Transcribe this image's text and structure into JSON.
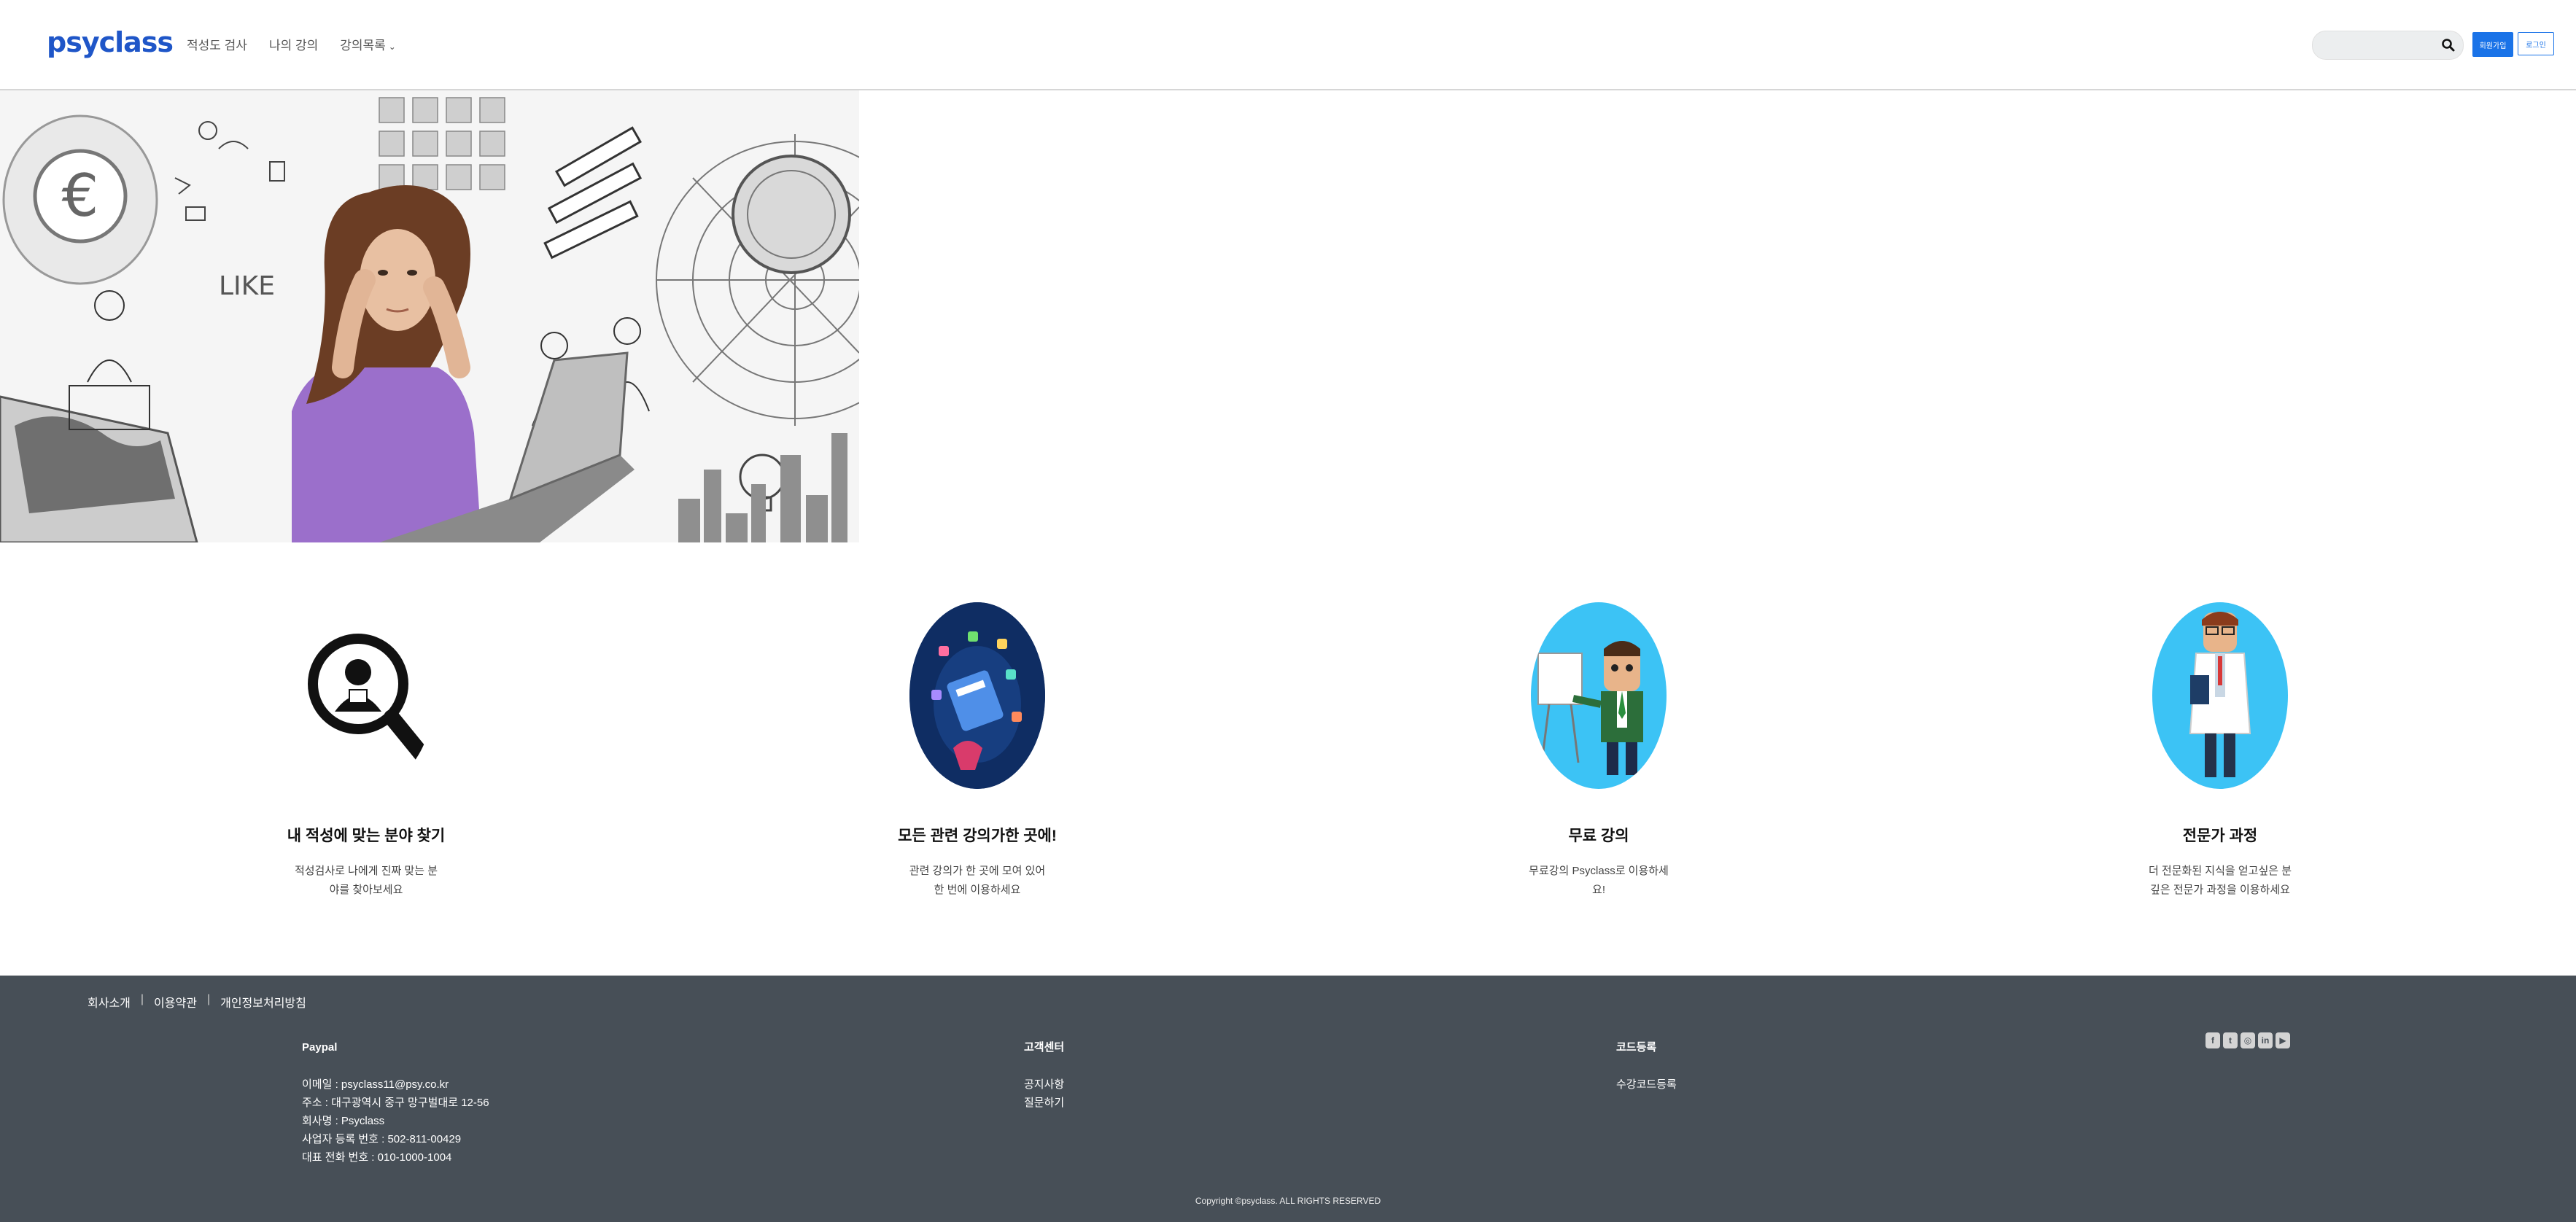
{
  "header": {
    "logo": "psyclass",
    "nav": [
      "적성도 검사",
      "나의 강의",
      "강의목록"
    ],
    "nav_caret": "⌄",
    "search_placeholder": "",
    "join_label": "회원가입",
    "login_label": "로그인"
  },
  "hero": {
    "icon": "collage-stressed-woman-laptop-image"
  },
  "features": [
    {
      "icon": "magnifier-person-icon",
      "title": "내 적성에 맞는 분야 찾기",
      "desc": "적성검사로 나에게 진짜 맞는 분야를 찾아보세요"
    },
    {
      "icon": "apps-illustration-icon",
      "title": "모든 관련 강의가한 곳에!",
      "desc": "관련 강의가 한 곳에 모여 있어 한 번에 이용하세요"
    },
    {
      "icon": "presenter-man-icon",
      "title": "무료 강의",
      "desc": "무료강의 Psyclass로 이용하세요!"
    },
    {
      "icon": "doctor-expert-icon",
      "title": "전문가 과정",
      "desc": "더 전문화된 지식을 얻고싶은 분 깊은 전문가 과정을 이용하세요"
    }
  ],
  "footer": {
    "links": [
      "회사소개",
      "이용약관",
      "개인정보처리방침"
    ],
    "link_sep": "|",
    "company": {
      "title": "Paypal",
      "lines": [
        "이메일 : psyclass11@psy.co.kr",
        "주소 : 대구광역시 중구 망구벌대로 12-56",
        "회사명 : Psyclass",
        "사업자 등록 번호 : 502-811-00429",
        "대표 전화 번호 : 010-1000-1004"
      ]
    },
    "support": {
      "title": "고객센터",
      "lines": [
        "공지사항",
        "질문하기"
      ]
    },
    "code": {
      "title": "코드등록",
      "lines": [
        "수강코드등록"
      ]
    },
    "social": [
      {
        "icon": "facebook-icon",
        "glyph": "f"
      },
      {
        "icon": "twitter-icon",
        "glyph": "t"
      },
      {
        "icon": "instagram-icon",
        "glyph": "◎"
      },
      {
        "icon": "linkedin-icon",
        "glyph": "in"
      },
      {
        "icon": "youtube-icon",
        "glyph": "▶"
      }
    ],
    "copyright": "Copyright ©psyclass. ALL RIGHTS RESERVED"
  },
  "colors": {
    "brand": "#1f56c8",
    "button": "#1a73e8",
    "footer_bg": "#474f57",
    "circle_blue": "#3cc3f5"
  }
}
